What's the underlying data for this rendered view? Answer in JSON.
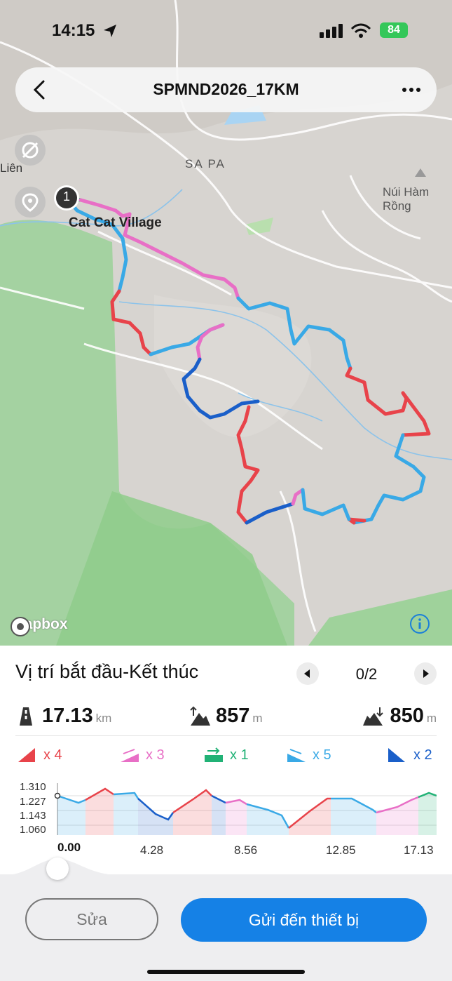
{
  "status_bar": {
    "time": "14:15",
    "battery": "84"
  },
  "header": {
    "title": "SPMND2026_17KM"
  },
  "map": {
    "labels": {
      "sapa": "SA PA",
      "lien": "Liên",
      "mountain": "Núi Hàm Rồng",
      "village": "Cat Cat Village",
      "start_marker": "1",
      "attribution": "mapbox"
    }
  },
  "panel": {
    "section_title": "Vị trí bắt đầu-Kết thúc",
    "pager": "0/2",
    "stats": {
      "distance": {
        "value": "17.13",
        "unit": "km"
      },
      "ascent": {
        "value": "857",
        "unit": "m"
      },
      "descent": {
        "value": "850",
        "unit": "m"
      }
    },
    "grades": [
      {
        "label": "x 4",
        "color": "#e8434a",
        "icon": "steep-climb-icon"
      },
      {
        "label": "x 3",
        "color": "#e86fc6",
        "icon": "moderate-climb-icon"
      },
      {
        "label": "x 1",
        "color": "#21b276",
        "icon": "flat-icon"
      },
      {
        "label": "x 5",
        "color": "#39a9e6",
        "icon": "moderate-descent-icon"
      },
      {
        "label": "x 2",
        "color": "#1a5fc9",
        "icon": "steep-descent-icon"
      }
    ],
    "profile": {
      "y_ticks": [
        "1.310",
        "1.227",
        "1.143",
        "1.060"
      ],
      "x_ticks": [
        "0.00",
        "4.28",
        "8.56",
        "12.85",
        "17.13"
      ]
    }
  },
  "actions": {
    "edit_label": "Sửa",
    "send_label": "Gửi đến thiết bị"
  },
  "colors": {
    "accent": "#1581e6",
    "red": "#e8434a",
    "pink": "#e86fc6",
    "green": "#21b276",
    "light_blue": "#39a9e6",
    "dark_blue": "#1a5fc9"
  }
}
